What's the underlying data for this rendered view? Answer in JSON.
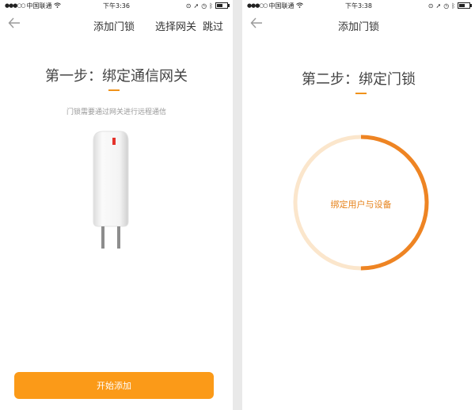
{
  "left": {
    "status": {
      "carrier": "中国联通",
      "time": "下午3:36"
    },
    "nav": {
      "title": "添加门锁",
      "action_select": "选择网关",
      "action_skip": "跳过"
    },
    "step_title": "第一步：绑定通信网关",
    "subtitle": "门锁需要通过网关进行远程通信",
    "button_label": "开始添加"
  },
  "right": {
    "status": {
      "carrier": "中国联通",
      "time": "下午3:38"
    },
    "nav": {
      "title": "添加门锁"
    },
    "step_title": "第二步：绑定门锁",
    "progress_label": "绑定用户与设备",
    "progress_fraction": 0.5
  },
  "colors": {
    "accent": "#f0921a",
    "button": "#fb9a18",
    "ring_track": "#fbe6cc",
    "ring_fill": "#ee8423"
  },
  "icons": {
    "back": "back-arrow-icon",
    "wifi": "wifi-icon",
    "battery": "battery-icon",
    "bluetooth": "bluetooth-icon",
    "alarm": "alarm-icon",
    "location": "location-icon",
    "gateway": "gateway-device-icon"
  }
}
